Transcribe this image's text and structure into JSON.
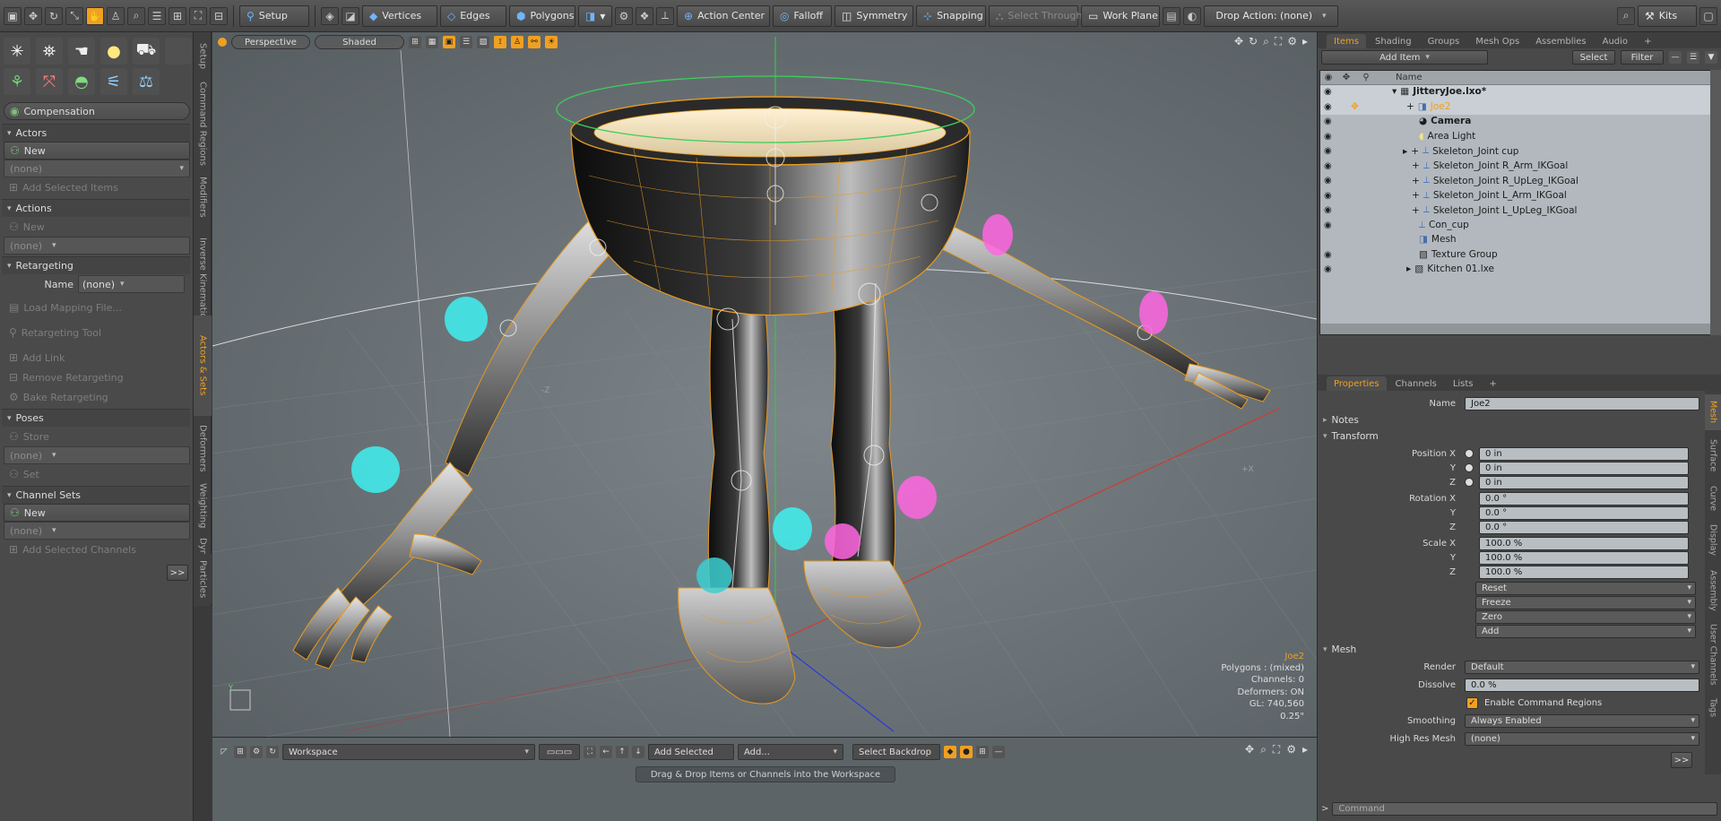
{
  "toolbar": {
    "setup": "Setup",
    "vertices": "Vertices",
    "edges": "Edges",
    "polygons": "Polygons",
    "action_center": "Action Center",
    "falloff": "Falloff",
    "symmetry": "Symmetry",
    "snapping": "Snapping",
    "select_through": "Select Through",
    "work_plane": "Work Plane",
    "drop_action": "Drop Action: (none)",
    "kits": "Kits"
  },
  "left_panel": {
    "compensation": "Compensation",
    "actors": {
      "title": "Actors",
      "new": "New",
      "none": "(none)",
      "add_selected": "Add Selected Items"
    },
    "actions": {
      "title": "Actions",
      "new": "New",
      "none": "(none)"
    },
    "retargeting": {
      "title": "Retargeting",
      "name_label": "Name",
      "name_value": "(none)",
      "load_mapping": "Load Mapping File...",
      "tool": "Retargeting Tool",
      "add_link": "Add Link",
      "remove": "Remove Retargeting",
      "bake": "Bake Retargeting"
    },
    "poses": {
      "title": "Poses",
      "store": "Store",
      "none": "(none)",
      "set": "Set"
    },
    "channel_sets": {
      "title": "Channel Sets",
      "new": "New",
      "none": "(none)",
      "add_selected": "Add Selected Channels"
    },
    "expand": ">>",
    "vertical_tabs": [
      "Setup",
      "Command Regions",
      "Modifiers",
      "Inverse Kinematics",
      "Actors & Sets",
      "Deformers",
      "Weighting",
      "Dynamics",
      "Particles"
    ]
  },
  "viewport": {
    "view": "Perspective",
    "shading": "Shaded",
    "axis_x": "+X",
    "axis_z": "-Z",
    "info": {
      "item": "Joe2",
      "polygons": "Polygons : (mixed)",
      "channels": "Channels: 0",
      "deformers": "Deformers: ON",
      "gl": "GL: 740,560",
      "scale": "0.25\""
    }
  },
  "bottom": {
    "workspace": "Workspace",
    "add_selected": "Add Selected",
    "add": "Add...",
    "select_backdrop": "Select Backdrop",
    "hint": "Drag & Drop Items or Channels into the Workspace"
  },
  "items_panel": {
    "tabs": [
      "Items",
      "Shading",
      "Groups",
      "Mesh Ops",
      "Assemblies",
      "Audio"
    ],
    "add_item": "Add Item",
    "select": "Select",
    "filter": "Filter",
    "column_name": "Name",
    "rows": [
      {
        "name": "JitteryJoe.lxo*",
        "bold": true
      },
      {
        "name": "Joe2",
        "current": true
      },
      {
        "name": "Camera",
        "bold": true
      },
      {
        "name": "Area Light"
      },
      {
        "name": "Skeleton_Joint cup"
      },
      {
        "name": "Skeleton_Joint R_Arm_IKGoal"
      },
      {
        "name": "Skeleton_Joint R_UpLeg_IKGoal"
      },
      {
        "name": "Skeleton_Joint L_Arm_IKGoal"
      },
      {
        "name": "Skeleton_Joint L_UpLeg_IKGoal"
      },
      {
        "name": "Con_cup"
      },
      {
        "name": "Mesh"
      },
      {
        "name": "Texture Group"
      },
      {
        "name": "Kitchen 01.lxe"
      }
    ]
  },
  "properties": {
    "tabs": [
      "Properties",
      "Channels",
      "Lists"
    ],
    "name_label": "Name",
    "name_value": "Joe2",
    "notes": "Notes",
    "transform": "Transform",
    "position_label": "Position X",
    "rotation_label": "Rotation X",
    "scale_label": "Scale X",
    "y": "Y",
    "z": "Z",
    "position": [
      "0 in",
      "0 in",
      "0 in"
    ],
    "rotation": [
      "0.0 °",
      "0.0 °",
      "0.0 °"
    ],
    "scale": [
      "100.0 %",
      "100.0 %",
      "100.0 %"
    ],
    "reset": "Reset",
    "freeze": "Freeze",
    "zero": "Zero",
    "add": "Add",
    "mesh": "Mesh",
    "render_label": "Render",
    "render_value": "Default",
    "dissolve_label": "Dissolve",
    "dissolve_value": "0.0 %",
    "enable_cmd_regions": "Enable Command Regions",
    "smoothing_label": "Smoothing",
    "smoothing_value": "Always Enabled",
    "high_res_label": "High Res Mesh",
    "high_res_value": "(none)",
    "expand": ">>",
    "side_tabs": [
      "Mesh",
      "Surface",
      "Curve",
      "Display",
      "Assembly",
      "User Channels",
      "Tags"
    ]
  },
  "command": {
    "prompt": ">",
    "placeholder": "Command"
  },
  "colors": {
    "accent": "#f0a020",
    "viewport_bg": "#6f777c",
    "cyan_handle": "#3ff0f0",
    "pink_handle": "#ff66e0"
  }
}
